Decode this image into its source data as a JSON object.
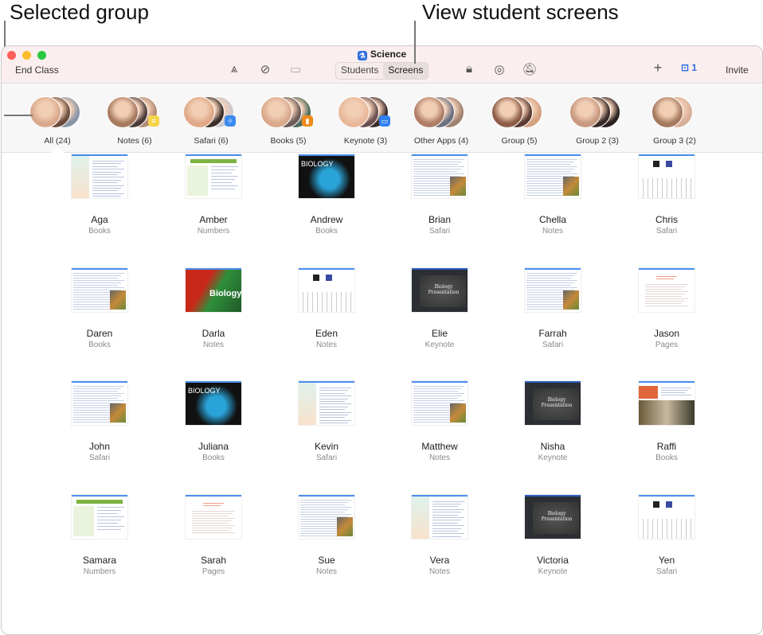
{
  "callouts": {
    "left": "Selected group",
    "right": "View student screens"
  },
  "window": {
    "title": "Science",
    "end_class": "End Class",
    "invite": "Invite",
    "inbox_count": "1",
    "segmented": {
      "students": "Students",
      "screens": "Screens",
      "selected": "Screens"
    },
    "toolbar_icons": [
      "apps-icon",
      "navigate-icon",
      "airplay-icon",
      "lock-icon",
      "hide-icon",
      "mute-icon",
      "add-icon",
      "inbox-icon"
    ]
  },
  "groups": [
    {
      "label": "All (24)",
      "selected": true,
      "colors": [
        "#d9a98c",
        "#6b4a3a",
        "#8895a8"
      ],
      "badge": null
    },
    {
      "label": "Notes (6)",
      "colors": [
        "#a77a60",
        "#4a3a3a",
        "#b28a70"
      ],
      "badge": "notes-icon"
    },
    {
      "label": "Safari (6)",
      "colors": [
        "#e0a888",
        "#3a2e2a",
        "#c9c9d2"
      ],
      "badge": "safari-icon"
    },
    {
      "label": "Books (5)",
      "colors": [
        "#d9a98c",
        "#6b5a58",
        "#4b6b5a"
      ],
      "badge": "books-icon"
    },
    {
      "label": "Keynote (3)",
      "colors": [
        "#e8b89a",
        "#6a5050",
        "#3a2a2a"
      ],
      "badge": "keynote-icon"
    },
    {
      "label": "Other Apps (4)",
      "colors": [
        "#b07e66",
        "#6a7080",
        "#a08070"
      ],
      "badge": null
    },
    {
      "label": "Group (5)",
      "colors": [
        "#8e5e48",
        "#5a3a30",
        "#d4a080"
      ],
      "badge": null
    },
    {
      "label": "Group 2 (3)",
      "colors": [
        "#c89a80",
        "#3a2a28",
        "#2a2020"
      ],
      "badge": null
    },
    {
      "label": "Group 3 (2)",
      "colors": [
        "#a67a5e",
        "#d8b098"
      ],
      "badge": null
    }
  ],
  "thumb_text": {
    "biology_caps": "BIOLOGY",
    "biology": "Biology",
    "presentation": "Biology Presentation"
  },
  "students": [
    {
      "name": "Aga",
      "app": "Books",
      "thumb": "notes"
    },
    {
      "name": "Amber",
      "app": "Numbers",
      "thumb": "numbers"
    },
    {
      "name": "Andrew",
      "app": "Books",
      "thumb": "bio-dark"
    },
    {
      "name": "Brian",
      "app": "Safari",
      "thumb": "safari"
    },
    {
      "name": "Chella",
      "app": "Notes",
      "thumb": "safari"
    },
    {
      "name": "Chris",
      "app": "Safari",
      "thumb": "keyboard"
    },
    {
      "name": "Daren",
      "app": "Books",
      "thumb": "safari"
    },
    {
      "name": "Darla",
      "app": "Notes",
      "thumb": "parrot"
    },
    {
      "name": "Eden",
      "app": "Notes",
      "thumb": "keyboard"
    },
    {
      "name": "Elie",
      "app": "Keynote",
      "thumb": "keynote"
    },
    {
      "name": "Farrah",
      "app": "Safari",
      "thumb": "safari"
    },
    {
      "name": "Jason",
      "app": "Pages",
      "thumb": "pages"
    },
    {
      "name": "John",
      "app": "Safari",
      "thumb": "safari"
    },
    {
      "name": "Juliana",
      "app": "Books",
      "thumb": "bio-dark"
    },
    {
      "name": "Kevin",
      "app": "Safari",
      "thumb": "notes"
    },
    {
      "name": "Matthew",
      "app": "Notes",
      "thumb": "safari"
    },
    {
      "name": "Nisha",
      "app": "Keynote",
      "thumb": "keynote"
    },
    {
      "name": "Raffi",
      "app": "Books",
      "thumb": "web-orange"
    },
    {
      "name": "Samara",
      "app": "Numbers",
      "thumb": "numbers"
    },
    {
      "name": "Sarah",
      "app": "Pages",
      "thumb": "pages"
    },
    {
      "name": "Sue",
      "app": "Notes",
      "thumb": "safari"
    },
    {
      "name": "Vera",
      "app": "Notes",
      "thumb": "notes"
    },
    {
      "name": "Victoria",
      "app": "Keynote",
      "thumb": "keynote"
    },
    {
      "name": "Yen",
      "app": "Safari",
      "thumb": "keyboard"
    }
  ],
  "colors": {
    "accent": "#2f6fdf",
    "titlebar": "#fbeeee",
    "close": "#fe5f57",
    "minimize": "#febc2e",
    "zoom": "#28c840"
  }
}
